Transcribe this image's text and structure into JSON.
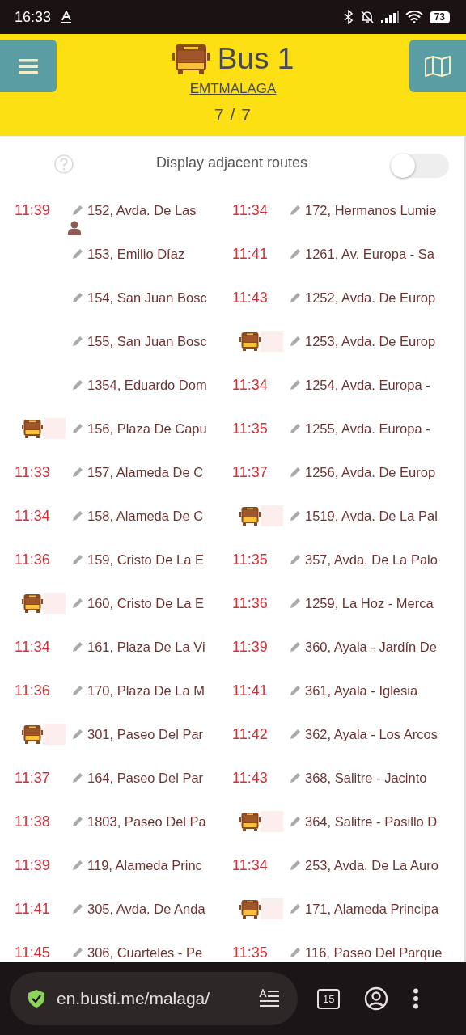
{
  "status_bar": {
    "time": "16:33",
    "battery": "73"
  },
  "header": {
    "title": "Bus 1",
    "operator": "EMTMALAGA",
    "counter": "7 / 7"
  },
  "adjacent_routes": {
    "label": "Display adjacent routes",
    "on": false
  },
  "columns": [
    {
      "stops": [
        {
          "name": "152, Avda. De Las",
          "arrival": {
            "kind": "time",
            "text": "11:39"
          },
          "user_here": true
        },
        {
          "name": "153, Emilio Díaz"
        },
        {
          "name": "154, San Juan Bosc"
        },
        {
          "name": "155, San Juan Bosc"
        },
        {
          "name": "1354, Eduardo Dom"
        },
        {
          "name": "156, Plaza De Capu",
          "arrival": {
            "kind": "bus"
          }
        },
        {
          "name": "157, Alameda De C",
          "arrival": {
            "kind": "time",
            "text": "11:33"
          }
        },
        {
          "name": "158, Alameda De C",
          "arrival": {
            "kind": "time",
            "text": "11:34"
          }
        },
        {
          "name": "159, Cristo De La E",
          "arrival": {
            "kind": "time",
            "text": "11:36"
          }
        },
        {
          "name": "160, Cristo De La E",
          "arrival": {
            "kind": "bus"
          }
        },
        {
          "name": "161, Plaza De La Vi",
          "arrival": {
            "kind": "time",
            "text": "11:34"
          }
        },
        {
          "name": "170, Plaza De La M",
          "arrival": {
            "kind": "time",
            "text": "11:36"
          }
        },
        {
          "name": "301, Paseo Del Par",
          "arrival": {
            "kind": "bus"
          }
        },
        {
          "name": "164, Paseo Del Par",
          "arrival": {
            "kind": "time",
            "text": "11:37"
          }
        },
        {
          "name": "1803, Paseo Del Pa",
          "arrival": {
            "kind": "time",
            "text": "11:38"
          }
        },
        {
          "name": "119, Alameda Princ",
          "arrival": {
            "kind": "time",
            "text": "11:39"
          }
        },
        {
          "name": "305, Avda. De Anda",
          "arrival": {
            "kind": "time",
            "text": "11:41"
          }
        },
        {
          "name": "306, Cuarteles - Pe",
          "arrival": {
            "kind": "time",
            "text": "11:45"
          }
        }
      ]
    },
    {
      "stops": [
        {
          "name": "172, Hermanos Lumie",
          "arrival": {
            "kind": "time",
            "text": "11:34"
          }
        },
        {
          "name": "1261, Av. Europa - Sa",
          "arrival": {
            "kind": "time",
            "text": "11:41"
          }
        },
        {
          "name": "1252, Avda. De Europ",
          "arrival": {
            "kind": "time",
            "text": "11:43"
          }
        },
        {
          "name": "1253, Avda. De Europ",
          "arrival": {
            "kind": "bus"
          }
        },
        {
          "name": "1254, Avda. Europa -",
          "arrival": {
            "kind": "time",
            "text": "11:34"
          }
        },
        {
          "name": "1255, Avda. Europa -",
          "arrival": {
            "kind": "time",
            "text": "11:35"
          }
        },
        {
          "name": "1256, Avda. De Europ",
          "arrival": {
            "kind": "time",
            "text": "11:37"
          }
        },
        {
          "name": "1519, Avda. De La Pal",
          "arrival": {
            "kind": "bus"
          }
        },
        {
          "name": "357, Avda. De La Palo",
          "arrival": {
            "kind": "time",
            "text": "11:35"
          }
        },
        {
          "name": "1259, La Hoz - Merca",
          "arrival": {
            "kind": "time",
            "text": "11:36"
          }
        },
        {
          "name": "360, Ayala - Jardín De",
          "arrival": {
            "kind": "time",
            "text": "11:39"
          }
        },
        {
          "name": "361, Ayala - Iglesia",
          "arrival": {
            "kind": "time",
            "text": "11:41"
          }
        },
        {
          "name": "362, Ayala - Los Arcos",
          "arrival": {
            "kind": "time",
            "text": "11:42"
          }
        },
        {
          "name": "368, Salitre - Jacinto",
          "arrival": {
            "kind": "time",
            "text": "11:43"
          }
        },
        {
          "name": "364, Salitre - Pasillo D",
          "arrival": {
            "kind": "bus"
          }
        },
        {
          "name": "253, Avda. De La Auro",
          "arrival": {
            "kind": "time",
            "text": "11:34"
          }
        },
        {
          "name": "171, Alameda Principa",
          "arrival": {
            "kind": "bus"
          }
        },
        {
          "name": "116, Paseo Del Parque",
          "arrival": {
            "kind": "time",
            "text": "11:35"
          }
        }
      ]
    }
  ],
  "browser": {
    "url": "en.busti.me/malaga/",
    "tabs_count": "15"
  }
}
